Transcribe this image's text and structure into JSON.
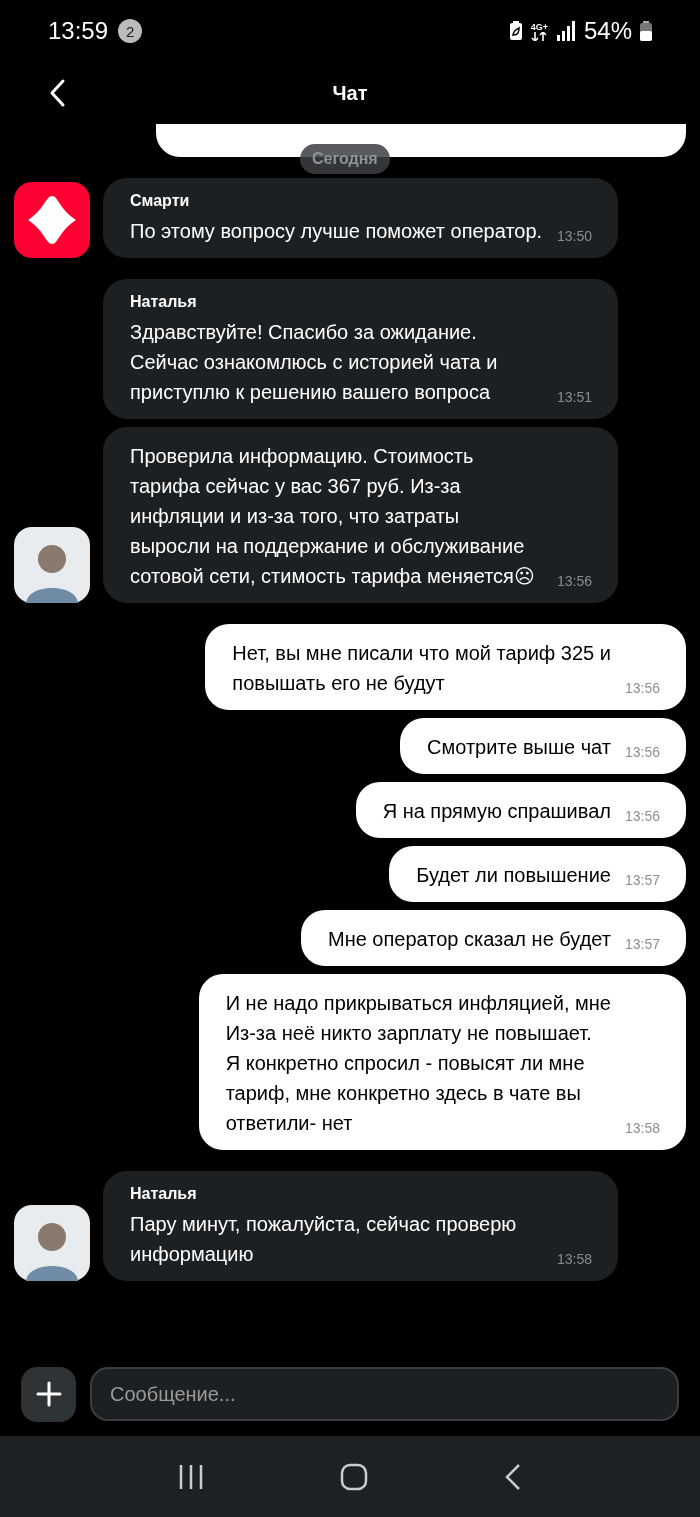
{
  "status_bar": {
    "time": "13:59",
    "notification_count": "2",
    "network": "4G+",
    "battery": "54%"
  },
  "header": {
    "title": "Чат"
  },
  "date_chip": "Сегодня",
  "messages": [
    {
      "kind": "clipped_outgoing"
    },
    {
      "kind": "incoming",
      "sender": "Смарти",
      "text": "По этому вопросу лучше поможет оператор.",
      "time": "13:50",
      "avatar": {
        "kind": "bot"
      }
    },
    {
      "kind": "incoming",
      "sender": "Наталья",
      "text": "Здравствуйте! Спасибо за ожидание.\nСейчас ознакомлюсь с историей чата и\nприступлю к решению вашего вопроса",
      "time": "13:51"
    },
    {
      "kind": "incoming",
      "text": "Проверила информацию. Стоимость\nтарифа сейчас у вас 367 руб. Из-за\nинфляции и из-за того, что затраты\nвыросли на поддержание и обслуживание\nсотовой сети, стимость тарифа меняется☹",
      "time": "13:56",
      "avatar": {
        "kind": "operator"
      }
    },
    {
      "kind": "outgoing",
      "text": "Нет, вы мне писали что мой тариф 325 и\nповышать его не будут",
      "time": "13:56"
    },
    {
      "kind": "outgoing",
      "text": "Смотрите выше чат",
      "time": "13:56"
    },
    {
      "kind": "outgoing",
      "text": "Я на прямую спрашивал",
      "time": "13:56"
    },
    {
      "kind": "outgoing",
      "text": "Будет ли повышение",
      "time": "13:57"
    },
    {
      "kind": "outgoing",
      "text": "Мне оператор сказал не будет",
      "time": "13:57"
    },
    {
      "kind": "outgoing",
      "text": "И не надо прикрываться инфляцией, мне\nИз-за неё никто зарплату не повышает.\nЯ конкретно спросил - повысят ли мне\nтариф, мне конкретно здесь в чате вы\nответили- нет",
      "time": "13:58"
    },
    {
      "kind": "incoming",
      "sender": "Наталья",
      "text": "Пару минут, пожалуйста, сейчас проверю\nинформацию",
      "time": "13:58",
      "avatar": {
        "kind": "operator"
      }
    }
  ],
  "composer": {
    "placeholder": "Сообщение..."
  }
}
